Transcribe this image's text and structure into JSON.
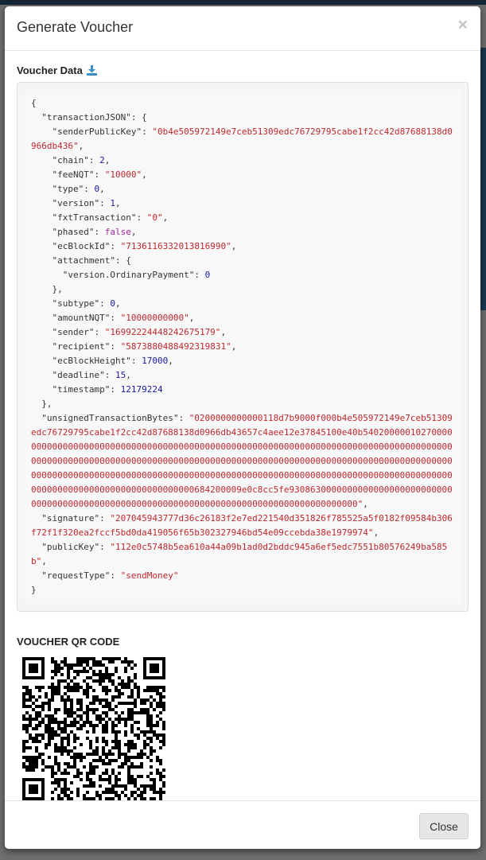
{
  "modal": {
    "title": "Generate Voucher",
    "close_glyph": "×",
    "voucher_data_label": "Voucher Data",
    "qr_label": "VOUCHER QR CODE",
    "close_button": "Close"
  },
  "voucher": {
    "transactionJSON": {
      "senderPublicKey": "0b4e505972149e7ceb51309edc76729795cabe1f2cc42d87688138d0966db436",
      "chain": 2,
      "feeNQT": "10000",
      "type": 0,
      "version": 1,
      "fxtTransaction": "0",
      "phased": false,
      "ecBlockId": "7136116332013816990",
      "attachment": {
        "version.OrdinaryPayment": 0
      },
      "subtype": 0,
      "amountNQT": "10000000000",
      "sender": "16992224448242675179",
      "recipient": "5873880488492319831",
      "ecBlockHeight": 17000,
      "deadline": 15,
      "timestamp": 12179224
    },
    "unsignedTransactionBytes": "0200000000000118d7b9000f000b4e505972149e7ceb51309edc76729795cabe1f2cc42d87688138d0966db43657c4aee12e37845100e40b540200000102700000000000000000000000000000000000000000000000000000000000000000000000000000000000000000000000000000000000000000000000000000000000000000000000000000000000000000000000000000000000000000000000000000000000000000000000000000000000000000000000000000000000000000000000000000000000684200009e0c8cc5fe930863000000000000000000000000000000000000000000000000000000000000000000000000000000000000000",
    "signature": "207045943777d36c26183f2e7ed221540d351826f785525a5f0182f09584b306f72f1f320ea2fccf5bd0da419056f65b302327946bd54e09ccebda38e1979974",
    "publicKey": "112e0c5748b5ea610a44a09b1ad0d2bddc945a6ef5edc7551b80576249ba585b",
    "requestType": "sendMoney"
  },
  "icons": {
    "download": "download-icon",
    "close": "close-icon",
    "qr": "qr-code"
  },
  "colors": {
    "string": "#c0282d",
    "number": "#1a1aa6",
    "boolean": "#a626a4"
  }
}
